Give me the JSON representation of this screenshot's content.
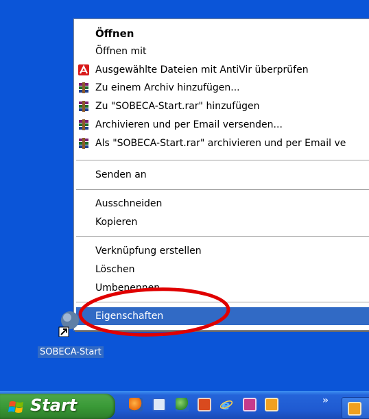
{
  "context_menu": {
    "items": [
      {
        "label": "Öffnen",
        "icon": "",
        "bold": true
      },
      {
        "label": "Öffnen mit",
        "icon": ""
      },
      {
        "label": "Ausgewählte Dateien mit AntiVir überprüfen",
        "icon": "antivir-icon"
      },
      {
        "label": "Zu einem Archiv hinzufügen...",
        "icon": "winrar-icon"
      },
      {
        "label": "Zu \"SOBECA-Start.rar\" hinzufügen",
        "icon": "winrar-icon"
      },
      {
        "label": "Archivieren und per Email versenden...",
        "icon": "winrar-icon"
      },
      {
        "label": "Als \"SOBECA-Start.rar\" archivieren und per Email ve",
        "icon": "winrar-icon"
      },
      {
        "label": "Senden an",
        "icon": ""
      },
      {
        "label": "Ausschneiden",
        "icon": ""
      },
      {
        "label": "Kopieren",
        "icon": ""
      },
      {
        "label": "Verknüpfung erstellen",
        "icon": ""
      },
      {
        "label": "Löschen",
        "icon": ""
      },
      {
        "label": "Umbenennen",
        "icon": ""
      },
      {
        "label": "Eigenschaften",
        "icon": "",
        "selected": true
      }
    ]
  },
  "desktop_icon": {
    "label": "SOBECA-Start",
    "icon": "shortcut-icon"
  },
  "taskbar": {
    "start_label": "Start",
    "quick_launch": [
      "firefox-icon",
      "window-icon",
      "messenger-icon",
      "media-icon",
      "ie-icon",
      "paint-icon",
      "clock-icon"
    ],
    "overflow_label": "»"
  },
  "colors": {
    "desktop": "#0b55d8",
    "selection": "#316ac5",
    "annotation": "#e00000",
    "start_green": "#3a9a37"
  }
}
